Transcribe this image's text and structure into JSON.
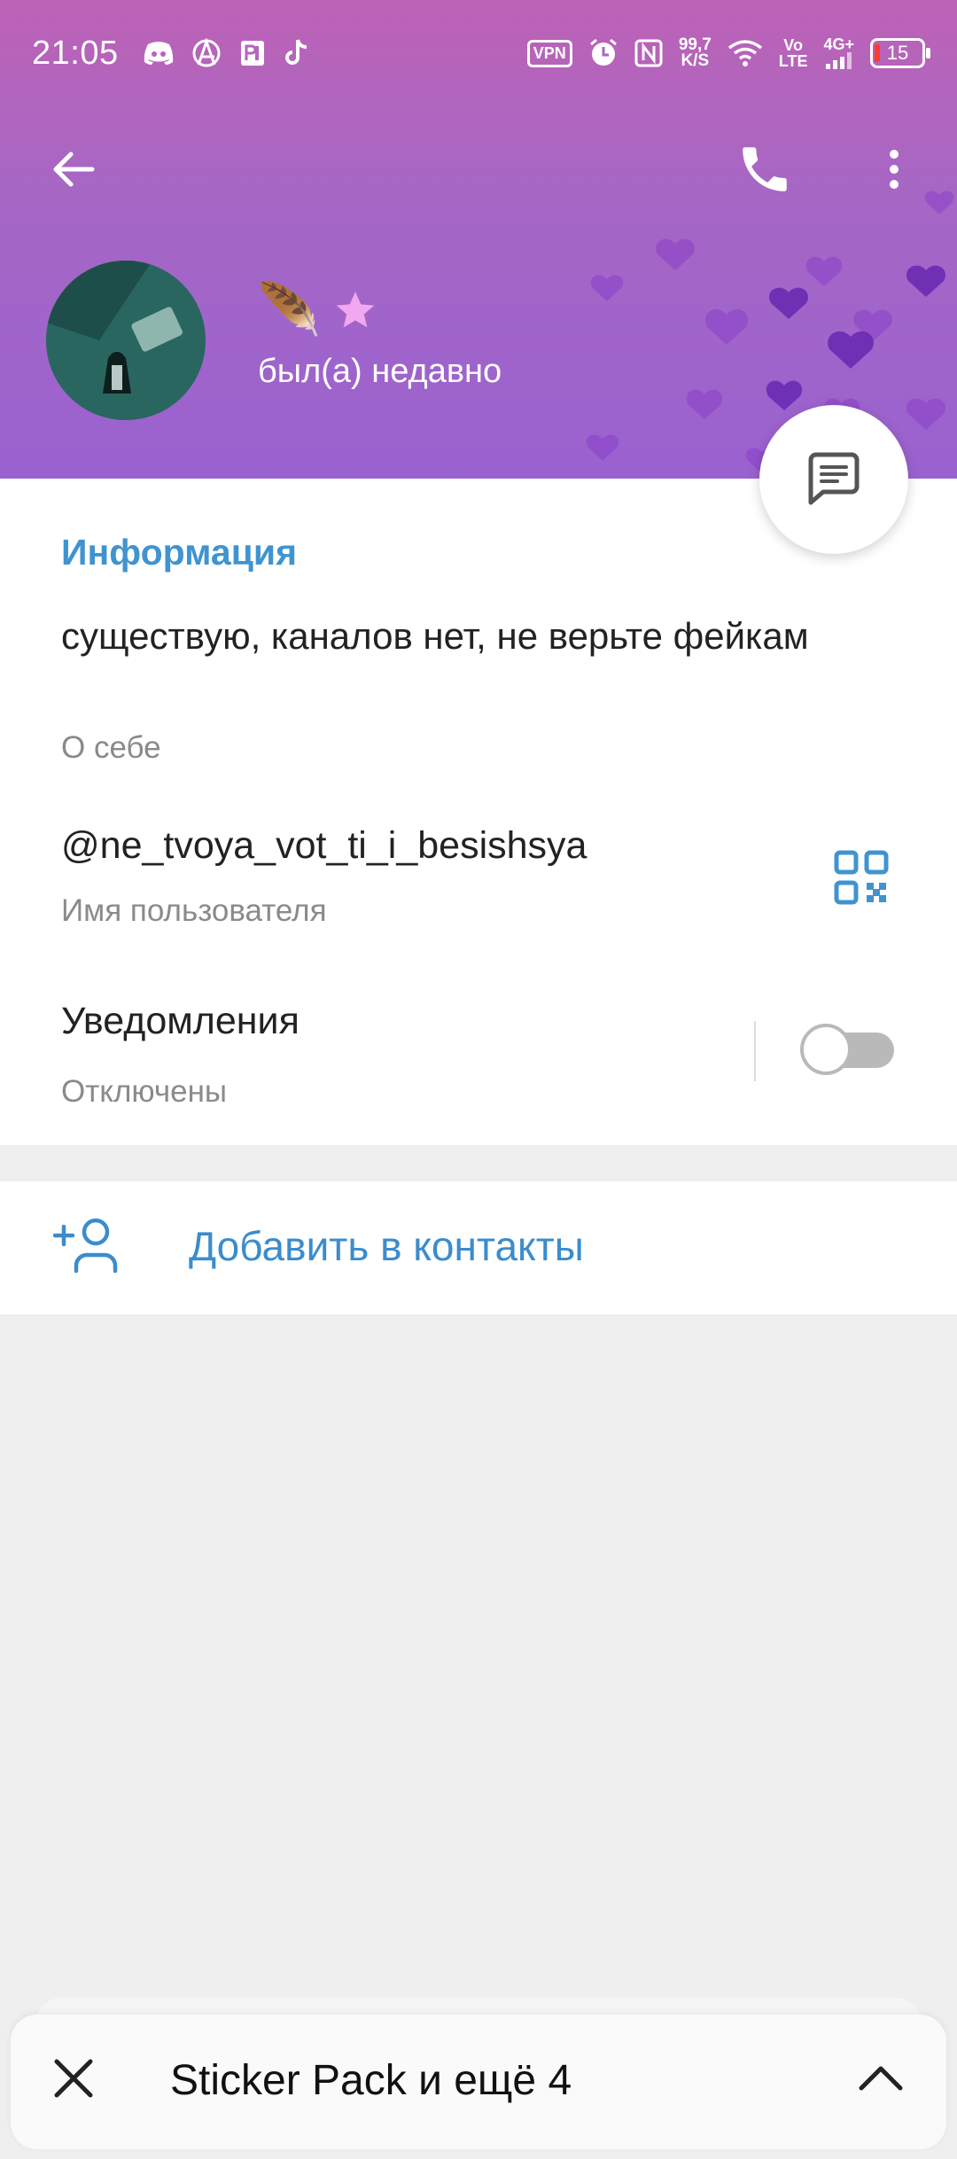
{
  "status_bar": {
    "time": "21:05",
    "speed_value": "99,7",
    "speed_unit": "K/S",
    "vpn": "VPN",
    "vo": "Vo",
    "lte": "LTE",
    "network": "4G+",
    "battery": "15",
    "icons": [
      "discord-icon",
      "anarchy-icon",
      "app-icon",
      "tiktok-icon",
      "vpn-icon",
      "alarm-icon",
      "nfc-icon",
      "wifi-icon",
      "signal-icon",
      "battery-icon"
    ]
  },
  "header": {
    "name_emoji": "🪶",
    "status": "был(а) недавно",
    "colors": {
      "gradient_top": "#bd62b6",
      "gradient_bottom": "#9a62d0",
      "hearts": "#7c3cc0"
    }
  },
  "info": {
    "section_title": "Информация",
    "bio": "существую, каналов нет, не верьте фейкам",
    "bio_label": "О себе",
    "username": "@ne_tvoya_vot_ti_i_besishsya",
    "username_label": "Имя пользователя",
    "notifications": "Уведомления",
    "notifications_status": "Отключены",
    "notifications_enabled": false
  },
  "actions": {
    "add_contact": "Добавить в контакты"
  },
  "bottom_bar": {
    "text": "Sticker Pack и ещё 4"
  },
  "colors": {
    "accent_blue": "#3f94d0",
    "toggle_off": "#b9b9b9"
  }
}
